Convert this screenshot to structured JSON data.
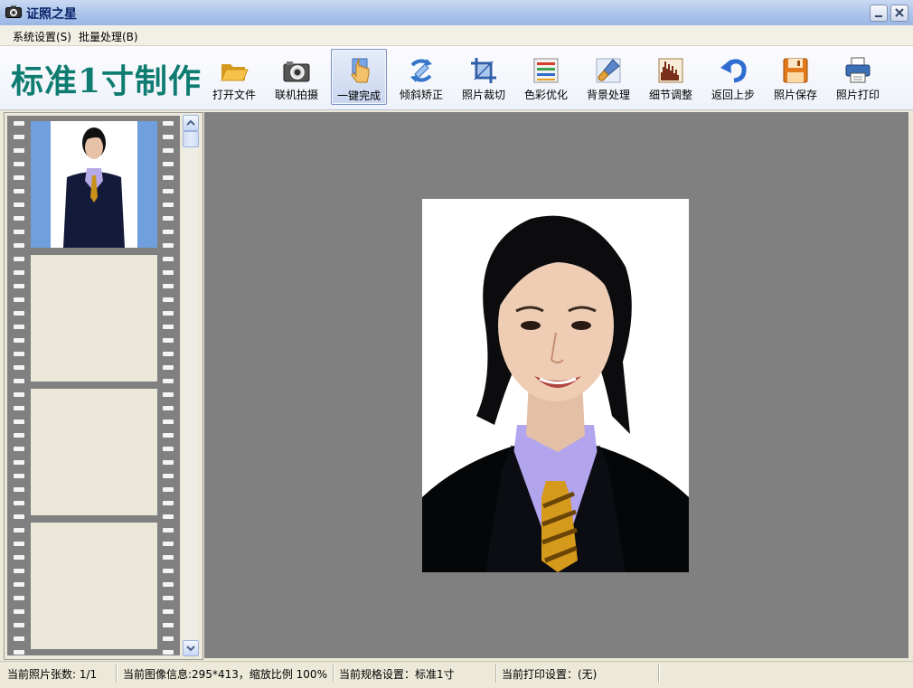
{
  "window": {
    "title": "证照之星"
  },
  "menu": {
    "items": [
      {
        "label": "系统设置(S)"
      },
      {
        "label": "批量处理(B)"
      }
    ]
  },
  "toolbar": {
    "brand": "标准1寸制作",
    "tools": [
      {
        "label": "打开文件",
        "icon": "folder-open-icon"
      },
      {
        "label": "联机拍摄",
        "icon": "camera-icon"
      },
      {
        "label": "一键完成",
        "icon": "hand-pointer-icon",
        "active": true
      },
      {
        "label": "倾斜矫正",
        "icon": "rotate-correct-icon"
      },
      {
        "label": "照片裁切",
        "icon": "crop-icon"
      },
      {
        "label": "色彩优化",
        "icon": "color-palette-icon"
      },
      {
        "label": "背景处理",
        "icon": "brush-icon"
      },
      {
        "label": "细节调整",
        "icon": "histogram-icon"
      },
      {
        "label": "返回上步",
        "icon": "undo-icon"
      },
      {
        "label": "照片保存",
        "icon": "save-floppy-icon"
      },
      {
        "label": "照片打印",
        "icon": "printer-icon"
      }
    ]
  },
  "filmstrip": {
    "frames": 4,
    "filled": 1
  },
  "status": {
    "count": "当前照片张数: 1/1",
    "image_info": "当前图像信息:295*413，缩放比例 100%",
    "spec": "当前规格设置：标准1寸",
    "print": "当前打印设置：(无)"
  },
  "colors": {
    "brand": "#0f7c72",
    "canvas_bg": "#808080",
    "thumb_bg": "#6f9fdc",
    "title_text": "#0a246a"
  }
}
